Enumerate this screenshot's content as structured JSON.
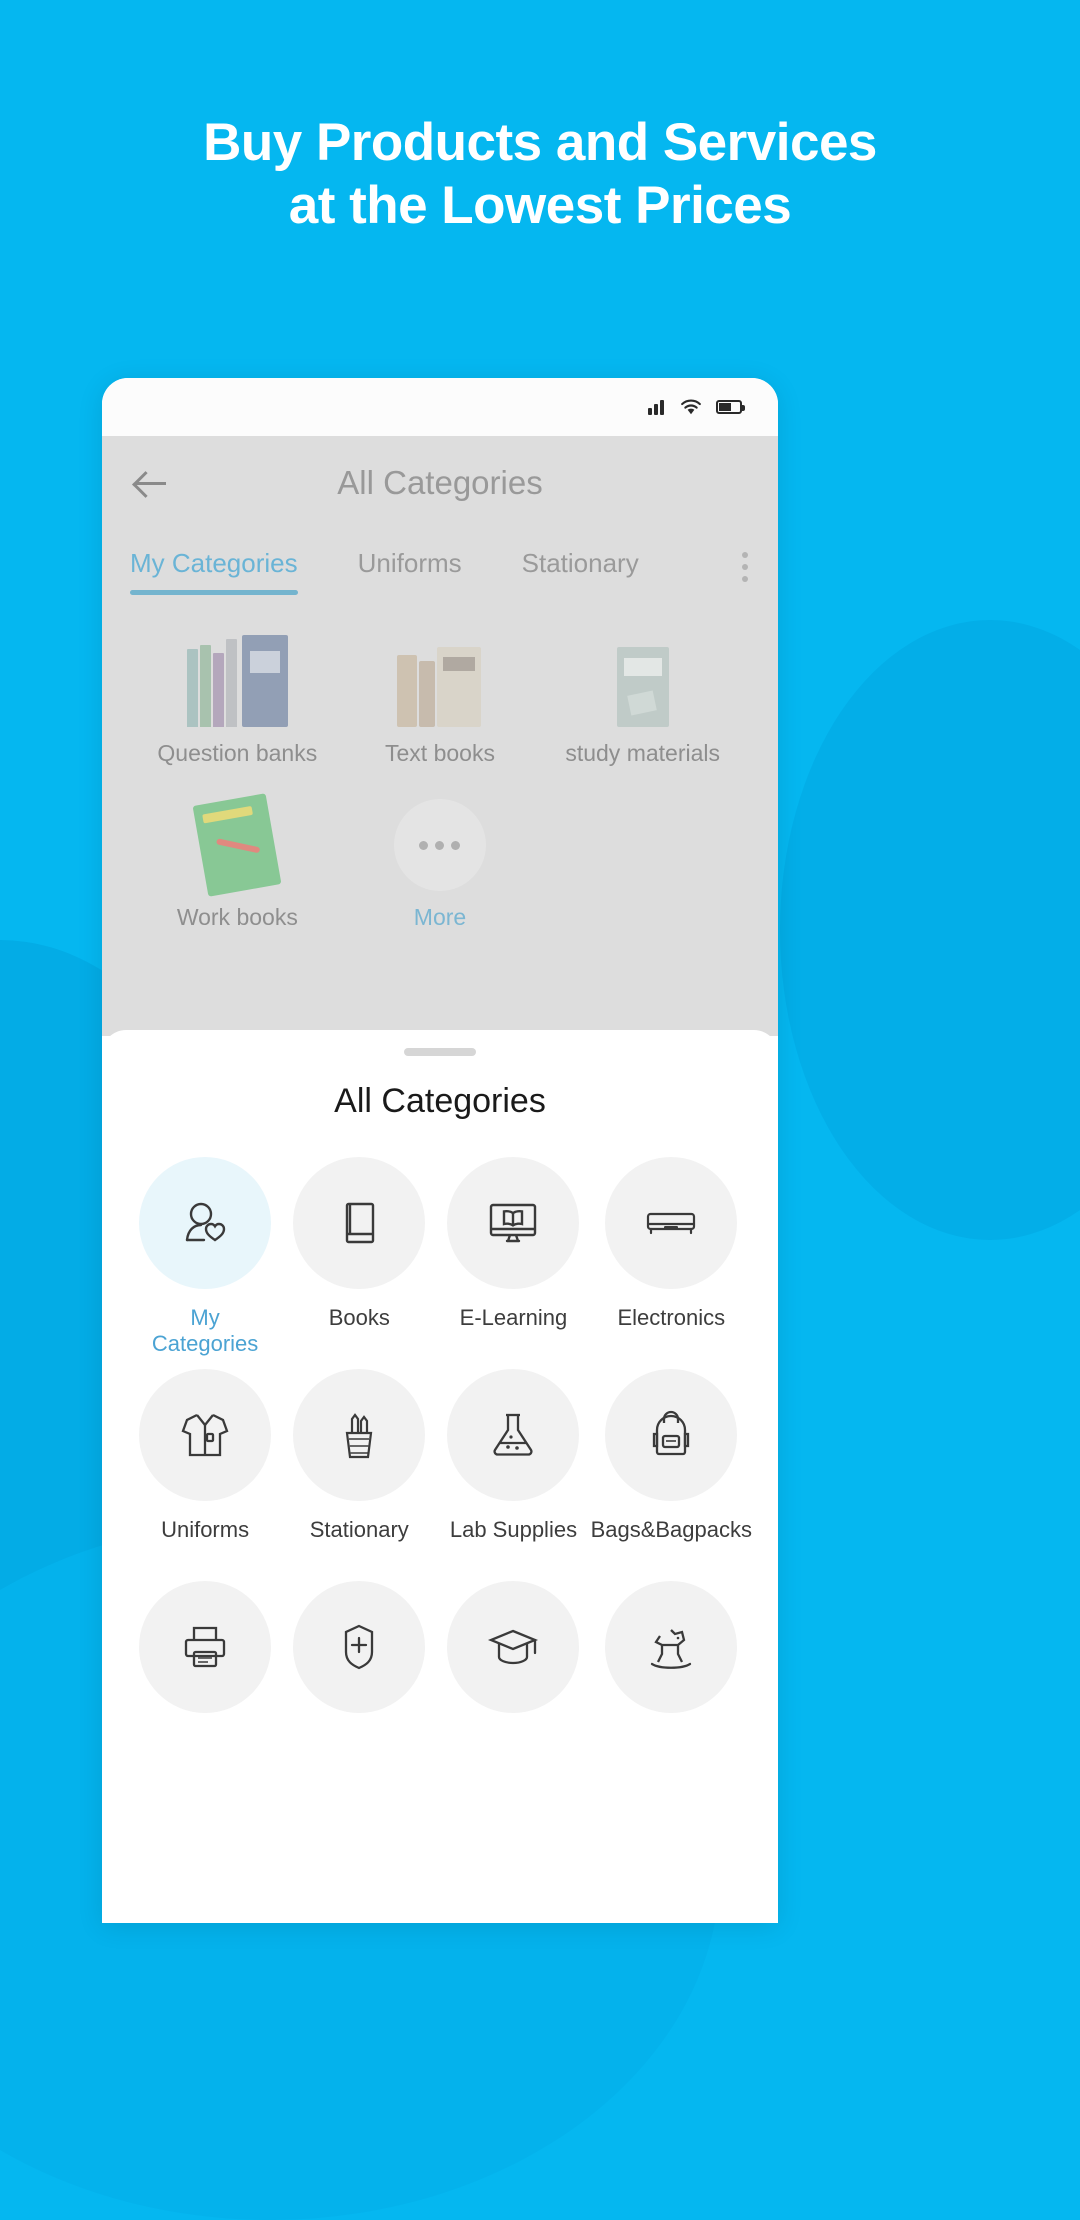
{
  "theme": {
    "background": "#05b7f0",
    "accent": "#4ba3d3",
    "sheet_bg": "#ffffff",
    "dim_bg": "#dddddd",
    "bubble_bg": "#f2f2f2",
    "bubble_selected_bg": "#e8f6fb"
  },
  "promo": {
    "line1": "Buy Products and Services",
    "line2": "at the Lowest Prices"
  },
  "phone": {
    "statusbar": {
      "signal_icon": "signal-bars-icon",
      "wifi_icon": "wifi-icon",
      "battery_icon": "battery-icon"
    },
    "appbar": {
      "back_icon": "back-arrow-icon",
      "title": "All Categories"
    },
    "tabs": {
      "items": [
        {
          "label": "My Categories",
          "active": true
        },
        {
          "label": "Uniforms",
          "active": false
        },
        {
          "label": "Stationary",
          "active": false
        }
      ],
      "overflow_icon": "more-vertical-icon"
    },
    "products": [
      {
        "label": "Question banks",
        "thumb": "stack-of-books-image"
      },
      {
        "label": "Text books",
        "thumb": "old-textbooks-image"
      },
      {
        "label": "study materials",
        "thumb": "study-material-book-image"
      },
      {
        "label": "Work books",
        "thumb": "green-workbook-image"
      },
      {
        "label": "More",
        "thumb": "more-dots-icon"
      }
    ]
  },
  "sheet": {
    "handle": "drag-handle",
    "title": "All Categories",
    "categories": [
      {
        "label": "My\nCategories",
        "label_line1": "My",
        "label_line2": "Categories",
        "icon": "person-heart-icon",
        "selected": true
      },
      {
        "label": "Books",
        "icon": "book-icon",
        "selected": false
      },
      {
        "label": "E-Learning",
        "icon": "monitor-book-icon",
        "selected": false
      },
      {
        "label": "Electronics",
        "icon": "air-conditioner-icon",
        "selected": false
      },
      {
        "label": "Uniforms",
        "icon": "shirt-icon",
        "selected": false
      },
      {
        "label": "Stationary",
        "icon": "pen-cup-icon",
        "selected": false
      },
      {
        "label": "Lab Supplies",
        "icon": "flask-icon",
        "selected": false
      },
      {
        "label": "Bags&Bagpacks",
        "icon": "backpack-icon",
        "selected": false
      },
      {
        "label": "",
        "icon": "printer-icon",
        "selected": false
      },
      {
        "label": "",
        "icon": "medical-bag-icon",
        "selected": false
      },
      {
        "label": "",
        "icon": "graduation-cap-icon",
        "selected": false
      },
      {
        "label": "",
        "icon": "rocking-horse-icon",
        "selected": false
      }
    ]
  }
}
